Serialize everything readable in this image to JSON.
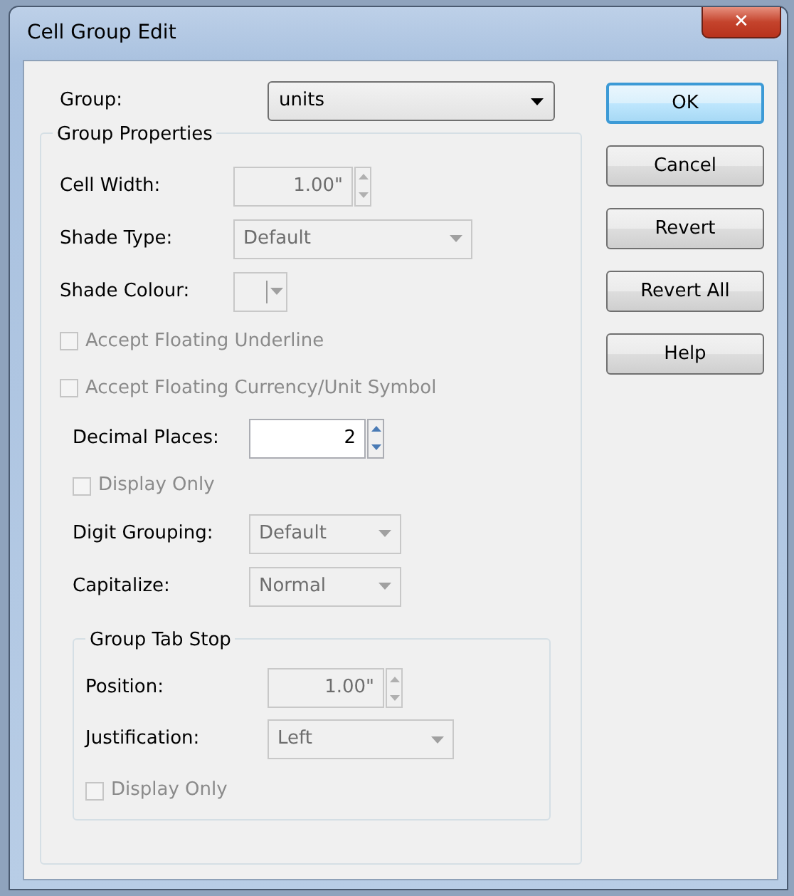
{
  "window": {
    "title": "Cell Group Edit",
    "close": "✕"
  },
  "group": {
    "label": "Group:",
    "value": "units"
  },
  "group_properties": {
    "title": "Group Properties",
    "items": [
      {
        "kind": "spin",
        "label": "Cell Width:",
        "value": "1.00\"",
        "disabled": true
      },
      {
        "kind": "combo",
        "label": "Shade Type:",
        "value": "Default",
        "disabled": true
      },
      {
        "kind": "color",
        "label": "Shade Colour:",
        "disabled": true
      },
      {
        "kind": "checkbox",
        "label": "Accept Floating Underline",
        "checked": false,
        "disabled": true
      },
      {
        "kind": "checkbox",
        "label": "Accept Floating Currency/Unit Symbol",
        "checked": false,
        "disabled": true
      }
    ],
    "number_format": [
      {
        "kind": "spin",
        "label": "Decimal Places:",
        "value": "2",
        "disabled": false
      },
      {
        "kind": "checkbox",
        "label": "Display Only",
        "checked": false,
        "disabled": true
      },
      {
        "kind": "combo",
        "label": "Digit Grouping:",
        "value": "Default",
        "disabled": true
      },
      {
        "kind": "combo",
        "label": "Capitalize:",
        "value": "Normal",
        "disabled": true
      }
    ],
    "tab_stop": {
      "title": "Group Tab Stop",
      "items": [
        {
          "kind": "spin",
          "label": "Position:",
          "value": "1.00\"",
          "disabled": true
        },
        {
          "kind": "combo",
          "label": "Justification:",
          "value": "Left",
          "disabled": true
        },
        {
          "kind": "checkbox",
          "label": "Display Only",
          "checked": false,
          "disabled": true
        }
      ]
    }
  },
  "buttons": [
    {
      "label": "OK",
      "default": true
    },
    {
      "label": "Cancel",
      "default": false
    },
    {
      "label": "Revert",
      "default": false
    },
    {
      "label": "Revert All",
      "default": false
    },
    {
      "label": "Help",
      "default": false
    }
  ]
}
